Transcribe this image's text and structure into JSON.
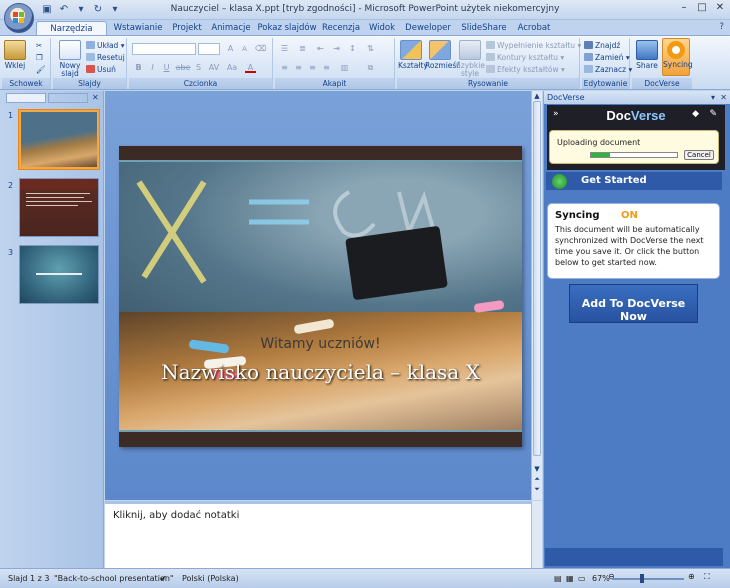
{
  "window": {
    "title": "Nauczyciel – klasa X.ppt [tryb zgodności] - Microsoft PowerPoint użytek niekomercyjny"
  },
  "qat": {
    "undo_sep": "▾",
    "customize": "▾"
  },
  "tabs": [
    {
      "label": "Narzędzia główne",
      "active": true
    },
    {
      "label": "Wstawianie"
    },
    {
      "label": "Projekt"
    },
    {
      "label": "Animacje"
    },
    {
      "label": "Pokaz slajdów"
    },
    {
      "label": "Recenzja"
    },
    {
      "label": "Widok"
    },
    {
      "label": "Deweloper"
    },
    {
      "label": "SlideShare"
    },
    {
      "label": "Acrobat"
    }
  ],
  "ribbon": {
    "clipboard": {
      "label": "Schowek",
      "paste": "Wklej"
    },
    "slides": {
      "label": "Slajdy",
      "new_slide": "Nowy",
      "new_slide2": "slajd",
      "layout": "Układ",
      "reset": "Resetuj",
      "delete": "Usuń"
    },
    "font": {
      "label": "Czcionka",
      "bold": "B",
      "italic": "I",
      "underline": "U",
      "strike": "abe",
      "shadow": "S",
      "spacing": "AV",
      "case": "Aa",
      "color": "A",
      "grow": "A",
      "shrink": "A"
    },
    "paragraph": {
      "label": "Akapit"
    },
    "drawing": {
      "label": "Rysowanie",
      "shapes": "Kształty",
      "arrange": "Rozmieść",
      "quick_styles": "Szybkie",
      "quick_styles2": "style",
      "fill": "Wypełnienie kształtu",
      "outline": "Kontury kształtu",
      "effects": "Efekty kształtów"
    },
    "editing": {
      "label": "Edytowanie",
      "find": "Znajdź",
      "replace": "Zamień",
      "select": "Zaznacz"
    },
    "docverse": {
      "label": "DocVerse",
      "share": "Share",
      "syncing": "Syncing"
    }
  },
  "thumbnails": [
    {
      "num": "1",
      "selected": true
    },
    {
      "num": "2"
    },
    {
      "num": "3"
    }
  ],
  "slide": {
    "subtitle": "Witamy uczniów!",
    "title": "Nazwisko nauczyciela – klasa X"
  },
  "notes": {
    "placeholder": "Kliknij, aby dodać notatki"
  },
  "taskpane": {
    "title": "DocVerse",
    "logo_a": "Doc",
    "logo_b": "Verse",
    "upload_text": "Uploading document",
    "upload_progress": 0.22,
    "cancel": "Cancel",
    "get_started": "Get Started",
    "sync_label": "Syncing",
    "sync_state": "ON",
    "sync_desc": "This document will be automatically synchronized with DocVerse the next time you save it.  Or click the button below to get started now.",
    "add_button": "Add To DocVerse Now"
  },
  "status": {
    "slide": "Slajd 1 z 3",
    "theme": "\"Back-to-school presentation\"",
    "language": "Polski (Polska)",
    "zoom": "67%"
  },
  "colors": {
    "accent": "#15428b",
    "ribbon_bg": "#dbe7f6",
    "sync_on": "#f39a13"
  }
}
